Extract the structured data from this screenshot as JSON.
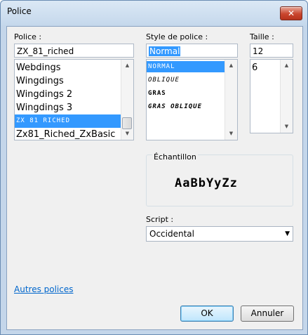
{
  "window": {
    "title": "Police",
    "close_glyph": "✕"
  },
  "font": {
    "label": "Police :",
    "value": "ZX_81_riched",
    "items": [
      "Webdings",
      "Wingdings",
      "Wingdings 2",
      "Wingdings 3",
      "ZX 81 RICHED",
      "Zx81_Riched_ZxBasic"
    ],
    "selected_index": 4
  },
  "style": {
    "label": "Style de police :",
    "value": "Normal",
    "items": [
      "NORMAL",
      "OBLIQUE",
      "GRAS",
      "GRAS OBLIQUE"
    ],
    "selected_index": 0
  },
  "size": {
    "label": "Taille :",
    "value": "12",
    "items": [
      "6"
    ]
  },
  "sample": {
    "label": "Échantillon",
    "text": "AaBbYyZz"
  },
  "script": {
    "label": "Script :",
    "value": "Occidental"
  },
  "more_fonts_link": "Autres polices",
  "buttons": {
    "ok": "OK",
    "cancel": "Annuler"
  },
  "icons": {
    "close": "close-icon",
    "scroll_up": "scroll-up-arrow-icon",
    "scroll_down": "scroll-down-arrow-icon",
    "dropdown": "chevron-down-icon"
  }
}
